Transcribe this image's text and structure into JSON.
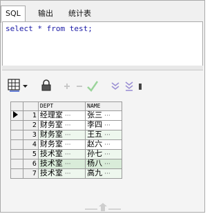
{
  "tabs": [
    {
      "label": "SQL",
      "active": true
    },
    {
      "label": "输出",
      "active": false
    },
    {
      "label": "统计表",
      "active": false
    }
  ],
  "editor": {
    "code": "select * from test;"
  },
  "toolbar": {
    "icons": [
      "grid-icon",
      "dropdown-arrow-icon",
      "lock-icon",
      "add-icon",
      "remove-icon",
      "confirm-icon",
      "filter-down-icon",
      "filter-all-icon",
      "more-icon"
    ],
    "colors": {
      "add": "#c8c8c8",
      "confirm": "#9bd49b",
      "filter": "#9b8fd4",
      "lock": "#555555"
    }
  },
  "grid": {
    "columns": [
      "DEPT",
      "NAME"
    ],
    "ellipsis": "···",
    "rows": [
      {
        "num": "1",
        "dept": "经理室",
        "name": "张三"
      },
      {
        "num": "2",
        "dept": "财务室",
        "name": "李四"
      },
      {
        "num": "3",
        "dept": "财务室",
        "name": "王五"
      },
      {
        "num": "4",
        "dept": "财务室",
        "name": "赵六"
      },
      {
        "num": "5",
        "dept": "技术室",
        "name": "孙七"
      },
      {
        "num": "6",
        "dept": "技术室",
        "name": "杨八"
      },
      {
        "num": "7",
        "dept": "技术室",
        "name": "高九"
      }
    ]
  }
}
